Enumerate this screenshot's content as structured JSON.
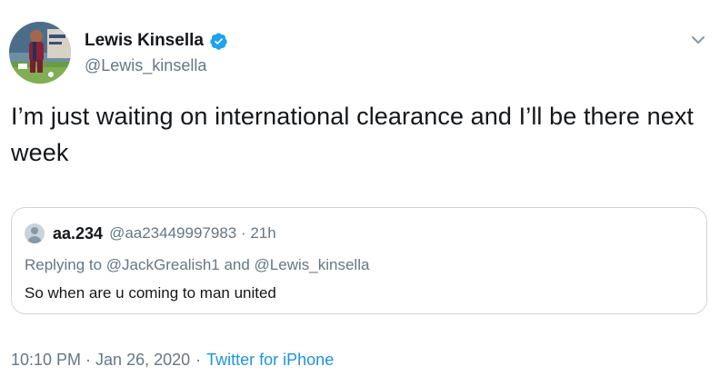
{
  "author": {
    "display_name": "Lewis Kinsella",
    "handle": "@Lewis_kinsella",
    "verified": true,
    "verified_color": "#1da1f2"
  },
  "tweet": {
    "text": "I’m just waiting on international clearance and I’ll be there next week"
  },
  "quote": {
    "name": "aa.234",
    "meta": "@aa23449997983 · 21h",
    "reply_to": "Replying to @JackGrealish1 and @Lewis_kinsella",
    "text": "So when are u coming to man united"
  },
  "footer": {
    "timestamp": "10:10 PM · Jan 26, 2020",
    "separator": "·",
    "source": "Twitter for iPhone",
    "link_color": "#1b95e0"
  },
  "icons": {
    "verified": "verified-badge-icon",
    "menu": "chevron-down-icon",
    "default_avatar": "default-avatar-icon"
  }
}
